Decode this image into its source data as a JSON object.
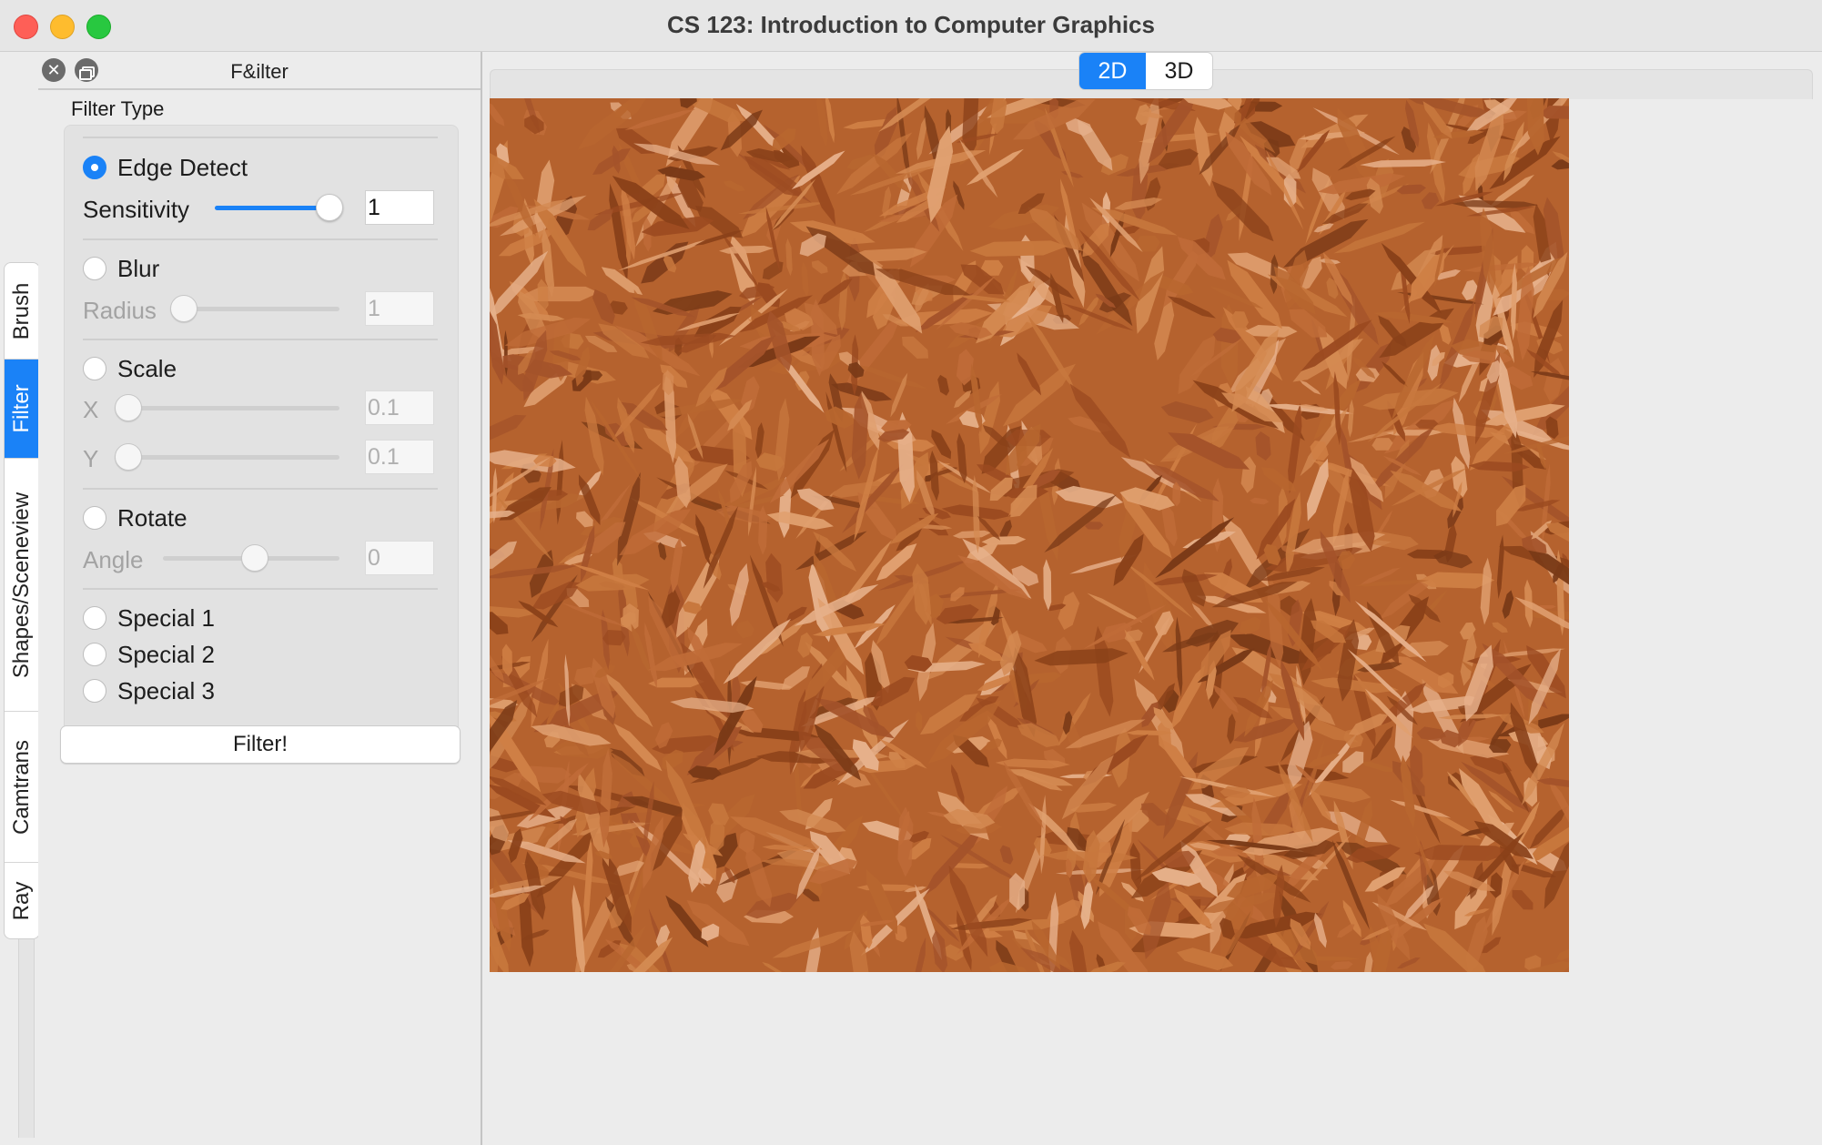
{
  "window": {
    "title": "CS 123: Introduction to Computer Graphics"
  },
  "side_tabs": [
    {
      "label": "Brush",
      "active": false
    },
    {
      "label": "Filter",
      "active": true
    },
    {
      "label": "Shapes/Sceneview",
      "active": false
    },
    {
      "label": "Camtrans",
      "active": false
    },
    {
      "label": "Ray",
      "active": false
    }
  ],
  "dock": {
    "title": "F&ilter",
    "group_label": "Filter Type",
    "edge_detect": {
      "label": "Edge Detect",
      "selected": true,
      "sensitivity": {
        "label": "Sensitivity",
        "value": "1",
        "level": 1.0
      }
    },
    "blur": {
      "label": "Blur",
      "selected": false,
      "radius": {
        "label": "Radius",
        "value": "1",
        "level": 0.0
      }
    },
    "scale": {
      "label": "Scale",
      "selected": false,
      "x": {
        "label": "X",
        "value": "0.1",
        "level": 0.0
      },
      "y": {
        "label": "Y",
        "value": "0.1",
        "level": 0.0
      }
    },
    "rotate": {
      "label": "Rotate",
      "selected": false,
      "angle": {
        "label": "Angle",
        "value": "0",
        "level": 0.5
      }
    },
    "special_1": {
      "label": "Special 1",
      "selected": false
    },
    "special_2": {
      "label": "Special 2",
      "selected": false
    },
    "special_3": {
      "label": "Special 3",
      "selected": false
    },
    "filter_button": "Filter!"
  },
  "main_tabs": [
    {
      "label": "2D",
      "active": true
    },
    {
      "label": "3D",
      "active": false
    }
  ],
  "canvas": {
    "image": "wood-mulch-texture",
    "colors": {
      "base": "#b5622e",
      "light": "#e3a174",
      "dark": "#7a3a17"
    }
  }
}
